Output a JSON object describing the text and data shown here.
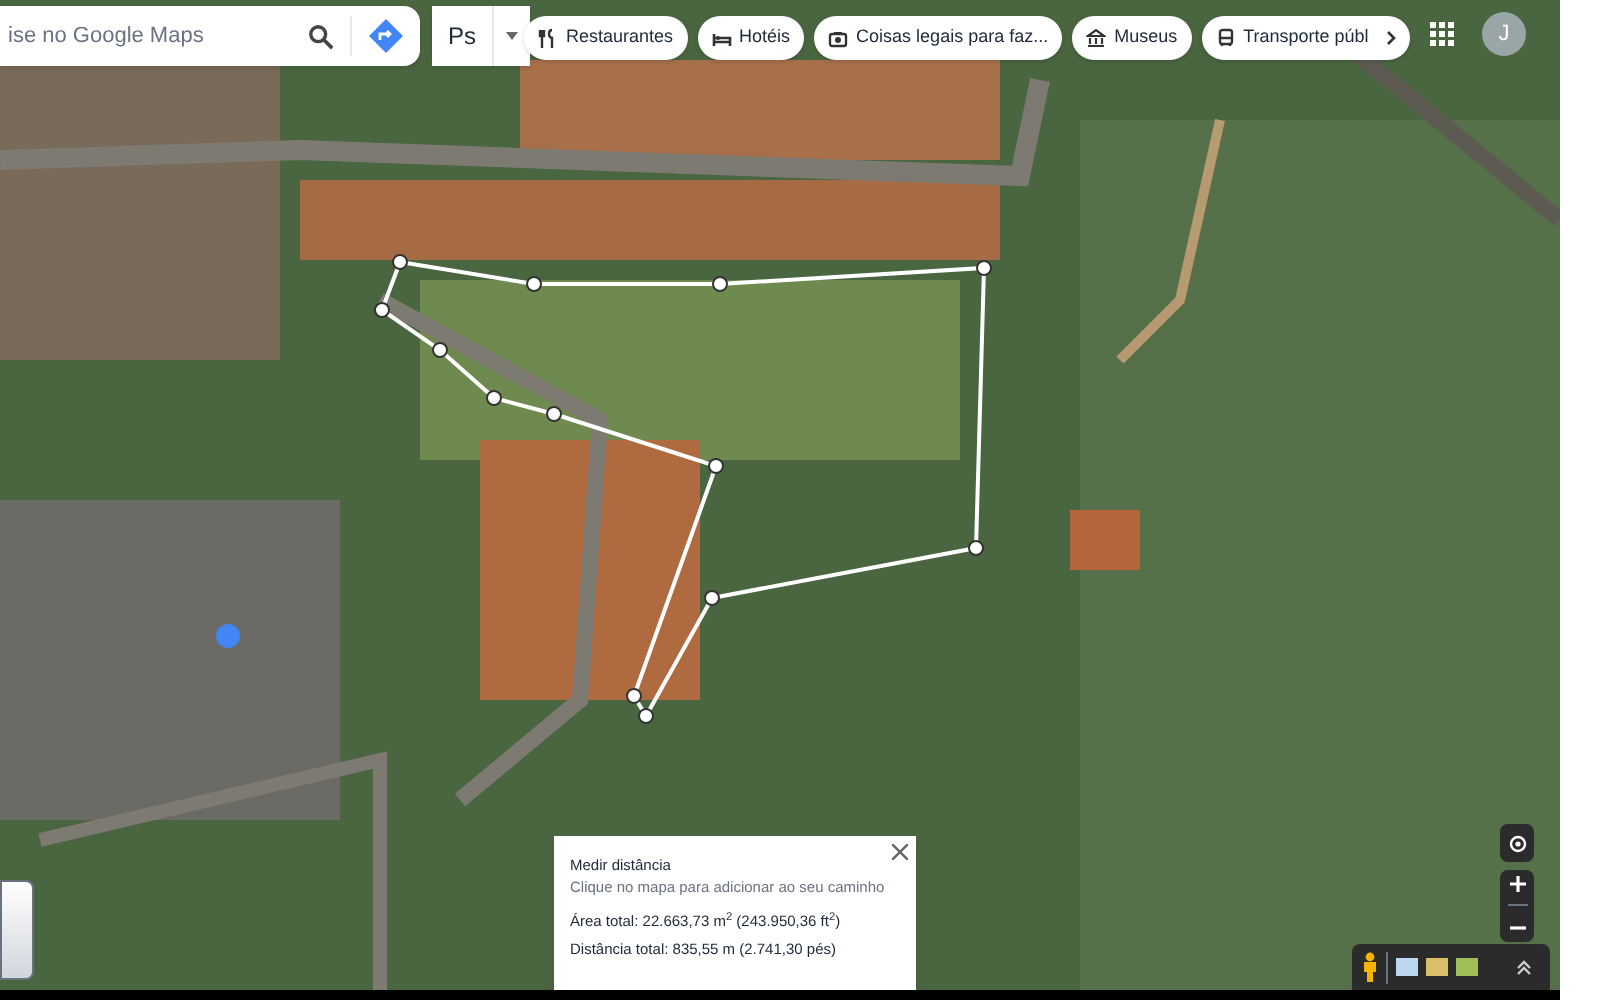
{
  "search": {
    "placeholder": "ise no Google Maps"
  },
  "profile_menu": {
    "label": "Ps"
  },
  "chips": [
    {
      "label": "Restaurantes"
    },
    {
      "label": "Hotéis"
    },
    {
      "label": "Coisas legais para faz..."
    },
    {
      "label": "Museus"
    },
    {
      "label": "Transporte públ"
    }
  ],
  "account": {
    "initial": "J"
  },
  "measure_panel": {
    "title": "Medir distância",
    "hint": "Clique no mapa para adicionar ao seu caminho",
    "area": "Área total: 22.663,73 m$^{2}$ (243.950,36 ft$^{2}$)",
    "distance": "Distância total: 835,55 m (2.741,30 pés)"
  }
}
